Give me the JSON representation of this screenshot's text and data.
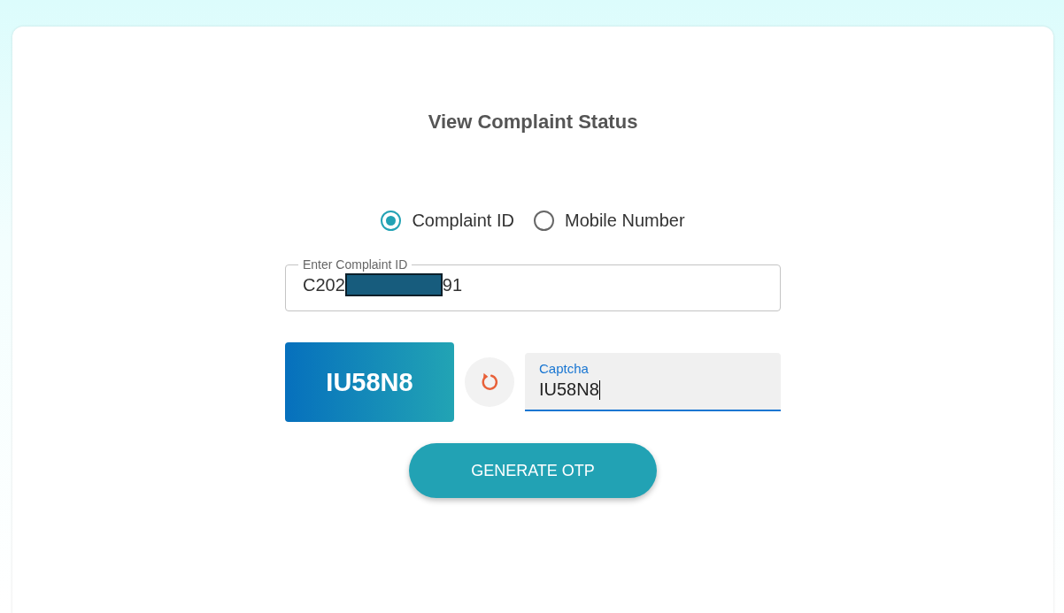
{
  "title": "View Complaint Status",
  "search_by": [
    {
      "label": "Complaint ID",
      "selected": true
    },
    {
      "label": "Mobile Number",
      "selected": false
    }
  ],
  "complaint_id_field": {
    "label": "Enter Complaint ID",
    "value_start": "C202",
    "value_end": "91",
    "redacted": true
  },
  "captcha": {
    "code": "IU58N8"
  },
  "captcha_field": {
    "label": "Captcha",
    "value": "IU58N8",
    "focused": true
  },
  "button": "GENERATE OTP"
}
